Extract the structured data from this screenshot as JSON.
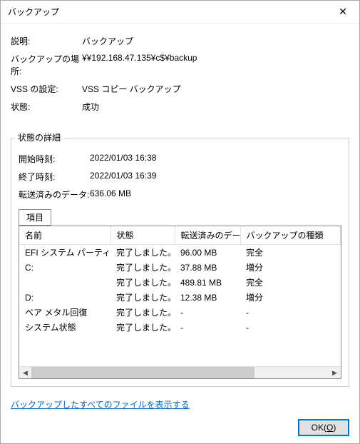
{
  "window": {
    "title": "バックアップ"
  },
  "summary": {
    "desc_label": "説明:",
    "desc_value": "バックアップ",
    "location_label": "バックアップの場所:",
    "location_value": "¥¥192.168.47.135¥c$¥backup",
    "vss_label": "VSS の設定:",
    "vss_value": "VSS コピー バックアップ",
    "status_label": "状態:",
    "status_value": "成功"
  },
  "details": {
    "group_label": "状態の詳細",
    "start_label": "開始時刻:",
    "start_value": "2022/01/03 16:38",
    "end_label": "終了時刻:",
    "end_value": "2022/01/03 16:39",
    "transferred_label": "転送済みのデータ:",
    "transferred_value": "636.06 MB",
    "tab_label": "項目",
    "columns": {
      "name": "名前",
      "status": "状態",
      "data": "転送済みのデータ",
      "type": "バックアップの種類"
    },
    "rows": [
      {
        "name": "EFI システム パーティション",
        "status": "完了しました。",
        "data": "96.00 MB",
        "type": "完全"
      },
      {
        "name": "C:",
        "status": "完了しました。",
        "data": "37.88 MB",
        "type": "増分"
      },
      {
        "name": "",
        "status": "完了しました。",
        "data": "489.81 MB",
        "type": "完全"
      },
      {
        "name": "D:",
        "status": "完了しました。",
        "data": "12.38 MB",
        "type": "増分"
      },
      {
        "name": "ベア メタル回復",
        "status": "完了しました。",
        "data": "-",
        "type": "-"
      },
      {
        "name": "システム状態",
        "status": "完了しました。",
        "data": "-",
        "type": "-"
      }
    ]
  },
  "footer": {
    "link_text": "バックアップしたすべてのファイルを表示する",
    "ok_label": "OK(O)"
  }
}
